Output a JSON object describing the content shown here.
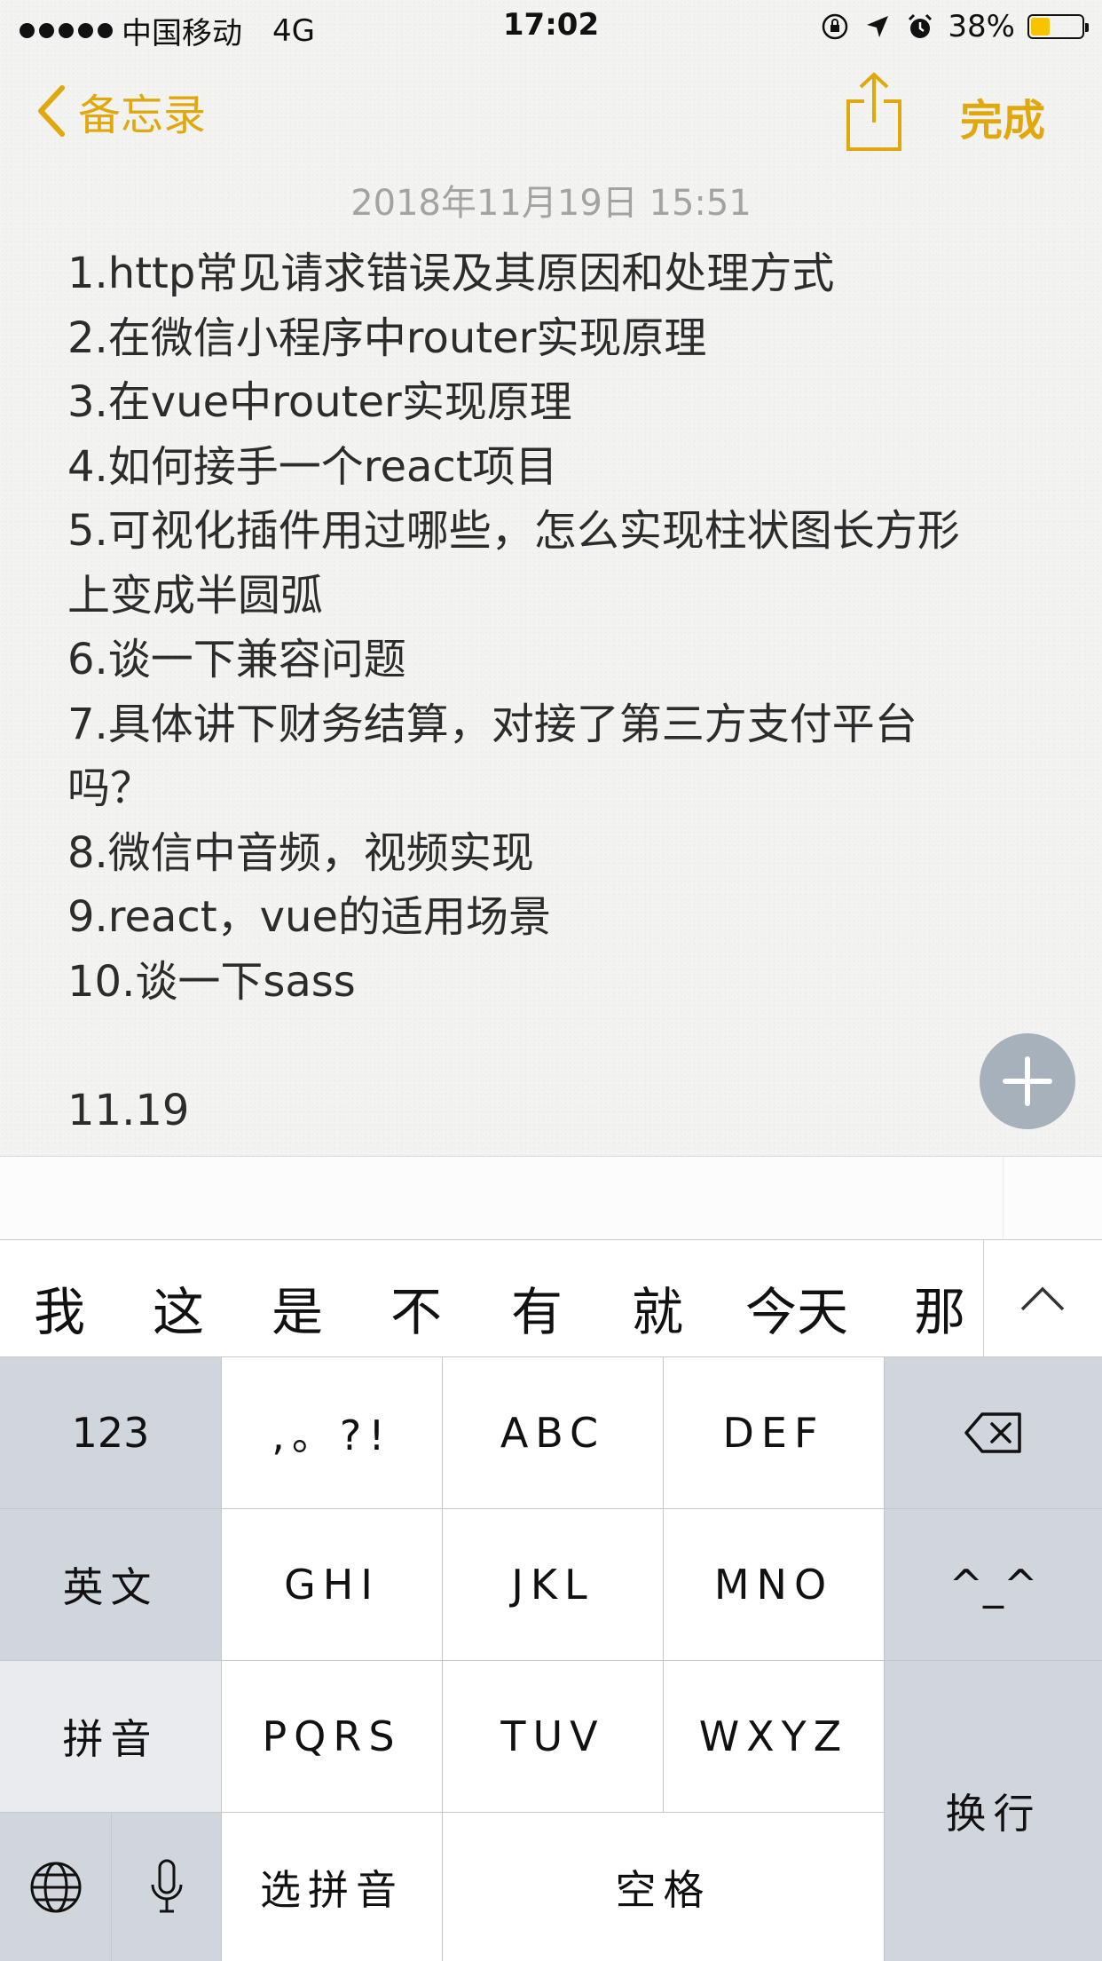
{
  "status_bar": {
    "carrier": "中国移动",
    "network": "4G",
    "time": "17:02",
    "battery_percent": "38%",
    "battery_level": 0.38,
    "battery_color": "#f7c500"
  },
  "nav": {
    "back_label": "备忘录",
    "done_label": "完成",
    "accent_color": "#e1a80e",
    "share_icon": "share-icon"
  },
  "note": {
    "date": "2018年11月19日 15:51",
    "lines": [
      "1.http常见请求错误及其原因和处理方式",
      "2.在微信小程序中router实现原理",
      "3.在vue中router实现原理",
      "4.如何接手一个react项目",
      "5.可视化插件用过哪些，怎么实现柱状图长方形",
      "上变成半圆弧",
      "6.谈一下兼容问题",
      "7.具体讲下财务结算，对接了第三方支付平台",
      "吗？",
      "8.微信中音频，视频实现",
      "9.react，vue的适用场景",
      "10.谈一下sass",
      "",
      "11.19"
    ]
  },
  "candidates": [
    "我",
    "这",
    "是",
    "不",
    "有",
    "就",
    "今天",
    "那"
  ],
  "keyboard": {
    "num_key": "123",
    "punct_key": ",。?!",
    "abc_key": "ABC",
    "def_key": "DEF",
    "ghi_key": "GHI",
    "jkl_key": "JKL",
    "mno_key": "MNO",
    "pqrs_key": "PQRS",
    "tuv_key": "TUV",
    "wxyz_key": "WXYZ",
    "english_key": "英文",
    "emoticon_key": "^_^",
    "pinyin_key": "拼音",
    "select_pinyin_key": "选拼音",
    "space_key": "空格",
    "return_key": "换行"
  }
}
